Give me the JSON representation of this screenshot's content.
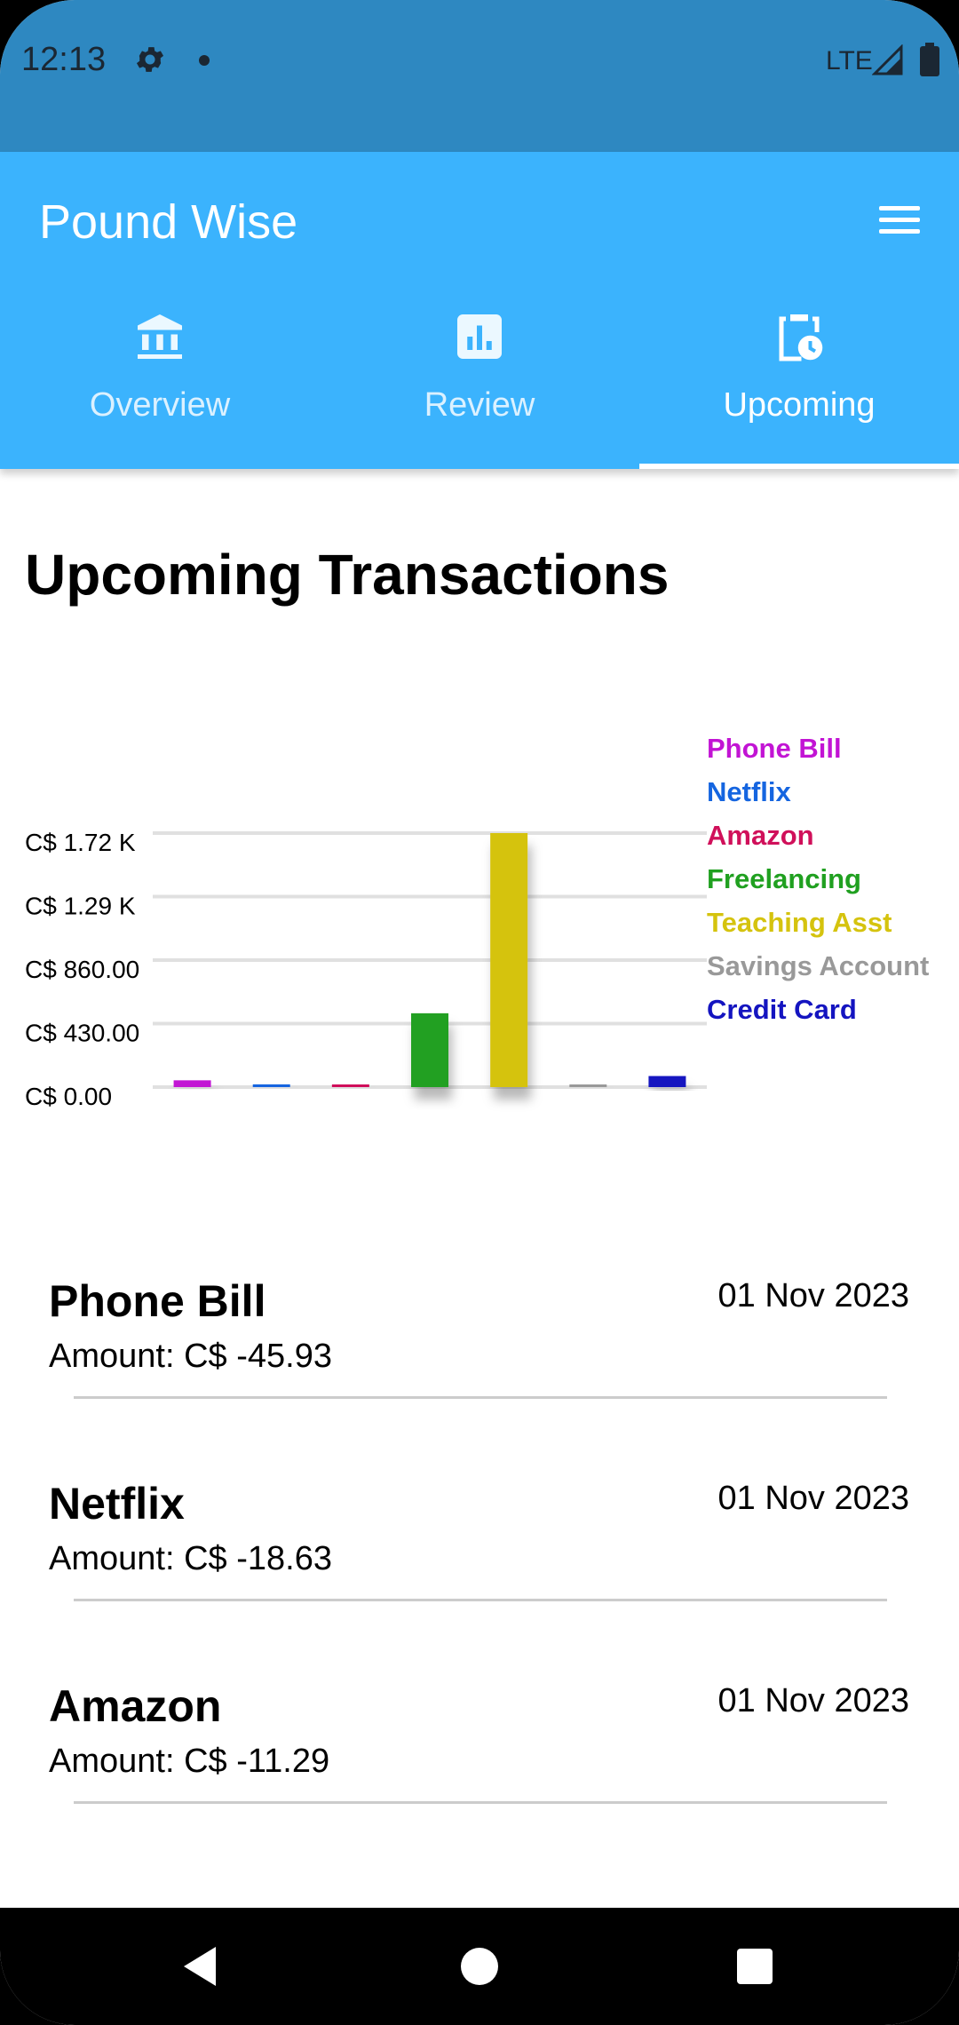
{
  "status_bar": {
    "time": "12:13",
    "network": "LTE",
    "icons": [
      "settings-icon",
      "notification-dot-icon",
      "signal-icon",
      "battery-icon"
    ]
  },
  "app_bar": {
    "title": "Pound Wise",
    "menu_icon": "menu-icon",
    "background": "#3bb3fd",
    "tabs": [
      {
        "label": "Overview",
        "icon": "bank-icon",
        "selected": false
      },
      {
        "label": "Review",
        "icon": "bar-chart-icon",
        "selected": false
      },
      {
        "label": "Upcoming",
        "icon": "clipboard-clock-icon",
        "selected": true
      }
    ]
  },
  "heading": "Upcoming Transactions",
  "chart_data": {
    "type": "bar",
    "categories": [
      "Phone Bill",
      "Netflix",
      "Amazon",
      "Freelancing",
      "Teaching Asst",
      "Savings Account",
      "Credit Card"
    ],
    "values": [
      45.93,
      18.63,
      11.29,
      500,
      1720,
      5,
      75
    ],
    "colors": [
      "#c214d4",
      "#1565e0",
      "#d0105a",
      "#20a020",
      "#d5c30e",
      "#999999",
      "#1414c0"
    ],
    "ylim": [
      0,
      1720
    ],
    "yticks": [
      "C$ 0.00",
      "C$ 430.00",
      "C$ 860.00",
      "C$ 1.29 K",
      "C$ 1.72 K"
    ],
    "ytick_values": [
      0,
      430,
      860,
      1290,
      1720
    ],
    "legend": [
      "Phone Bill",
      "Netflix",
      "Amazon",
      "Freelancing",
      "Teaching Asst",
      "Savings Account",
      "Credit Card"
    ],
    "legend_position": "right",
    "grid": true
  },
  "transactions": [
    {
      "name": "Phone Bill",
      "date": "01 Nov 2023",
      "amount": "Amount: C$ -45.93"
    },
    {
      "name": "Netflix",
      "date": "01 Nov 2023",
      "amount": "Amount: C$ -18.63"
    },
    {
      "name": "Amazon",
      "date": "01 Nov 2023",
      "amount": "Amount: C$ -11.29"
    }
  ],
  "nav_bar": {
    "buttons": [
      "back-icon",
      "home-icon",
      "recents-icon"
    ]
  }
}
